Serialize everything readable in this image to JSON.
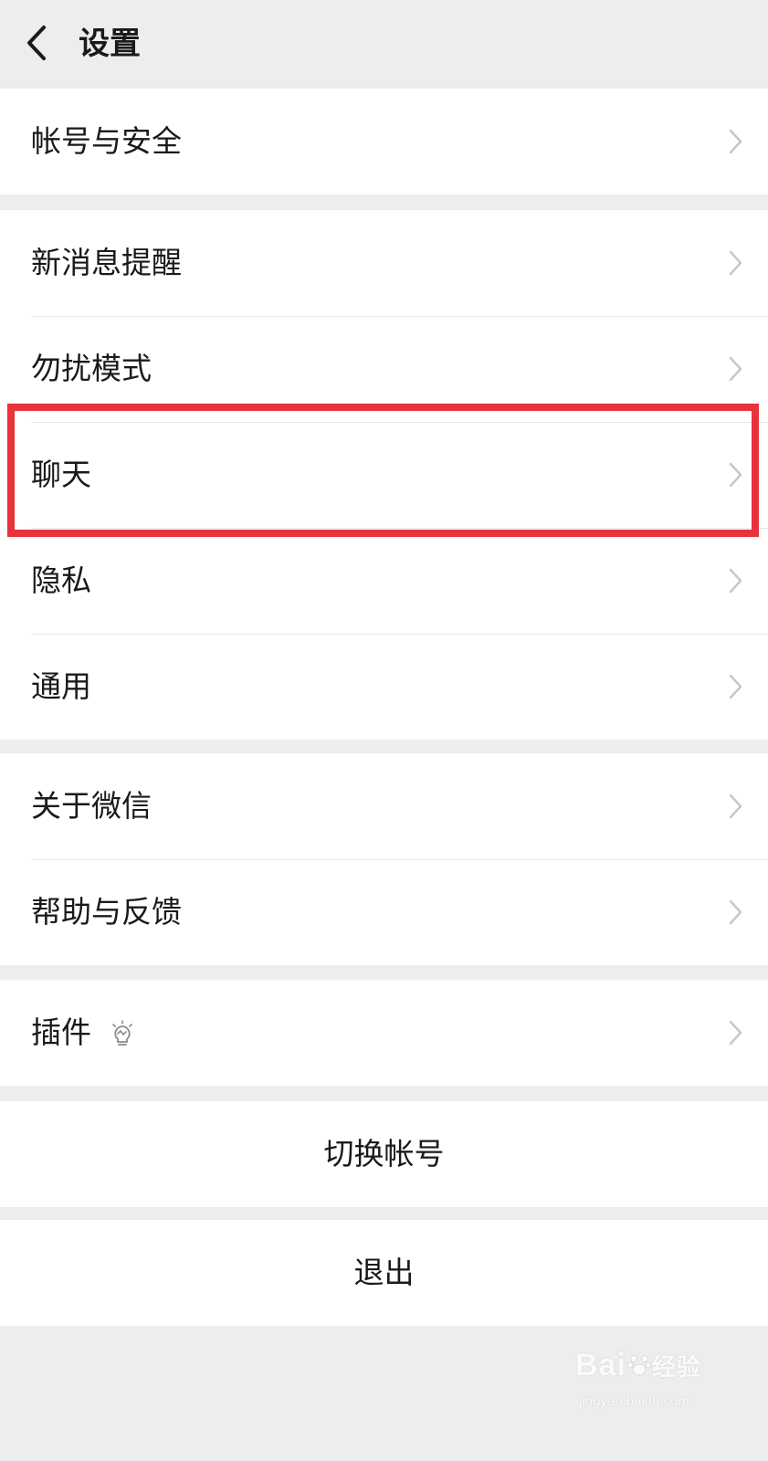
{
  "header": {
    "title": "设置",
    "back_icon": "chevron-left-icon"
  },
  "groups": [
    {
      "items": [
        {
          "label": "帐号与安全"
        }
      ]
    },
    {
      "items": [
        {
          "label": "新消息提醒"
        },
        {
          "label": "勿扰模式"
        },
        {
          "label": "聊天"
        },
        {
          "label": "隐私"
        },
        {
          "label": "通用"
        }
      ]
    },
    {
      "items": [
        {
          "label": "关于微信"
        },
        {
          "label": "帮助与反馈"
        }
      ]
    },
    {
      "items": [
        {
          "label": "插件",
          "badge_icon": "bulb-icon"
        }
      ]
    }
  ],
  "actions": {
    "switch_account": "切换帐号",
    "logout": "退出"
  },
  "highlight": {
    "target": "聊天",
    "color": "#e8323c"
  },
  "watermark": {
    "brand": "Bai",
    "brand_cn": "经验",
    "url": "jingyan.baidu.com"
  },
  "colors": {
    "background": "#ededed",
    "card": "#ffffff",
    "text": "#1a1a1a",
    "chevron": "#c7c7c7"
  }
}
